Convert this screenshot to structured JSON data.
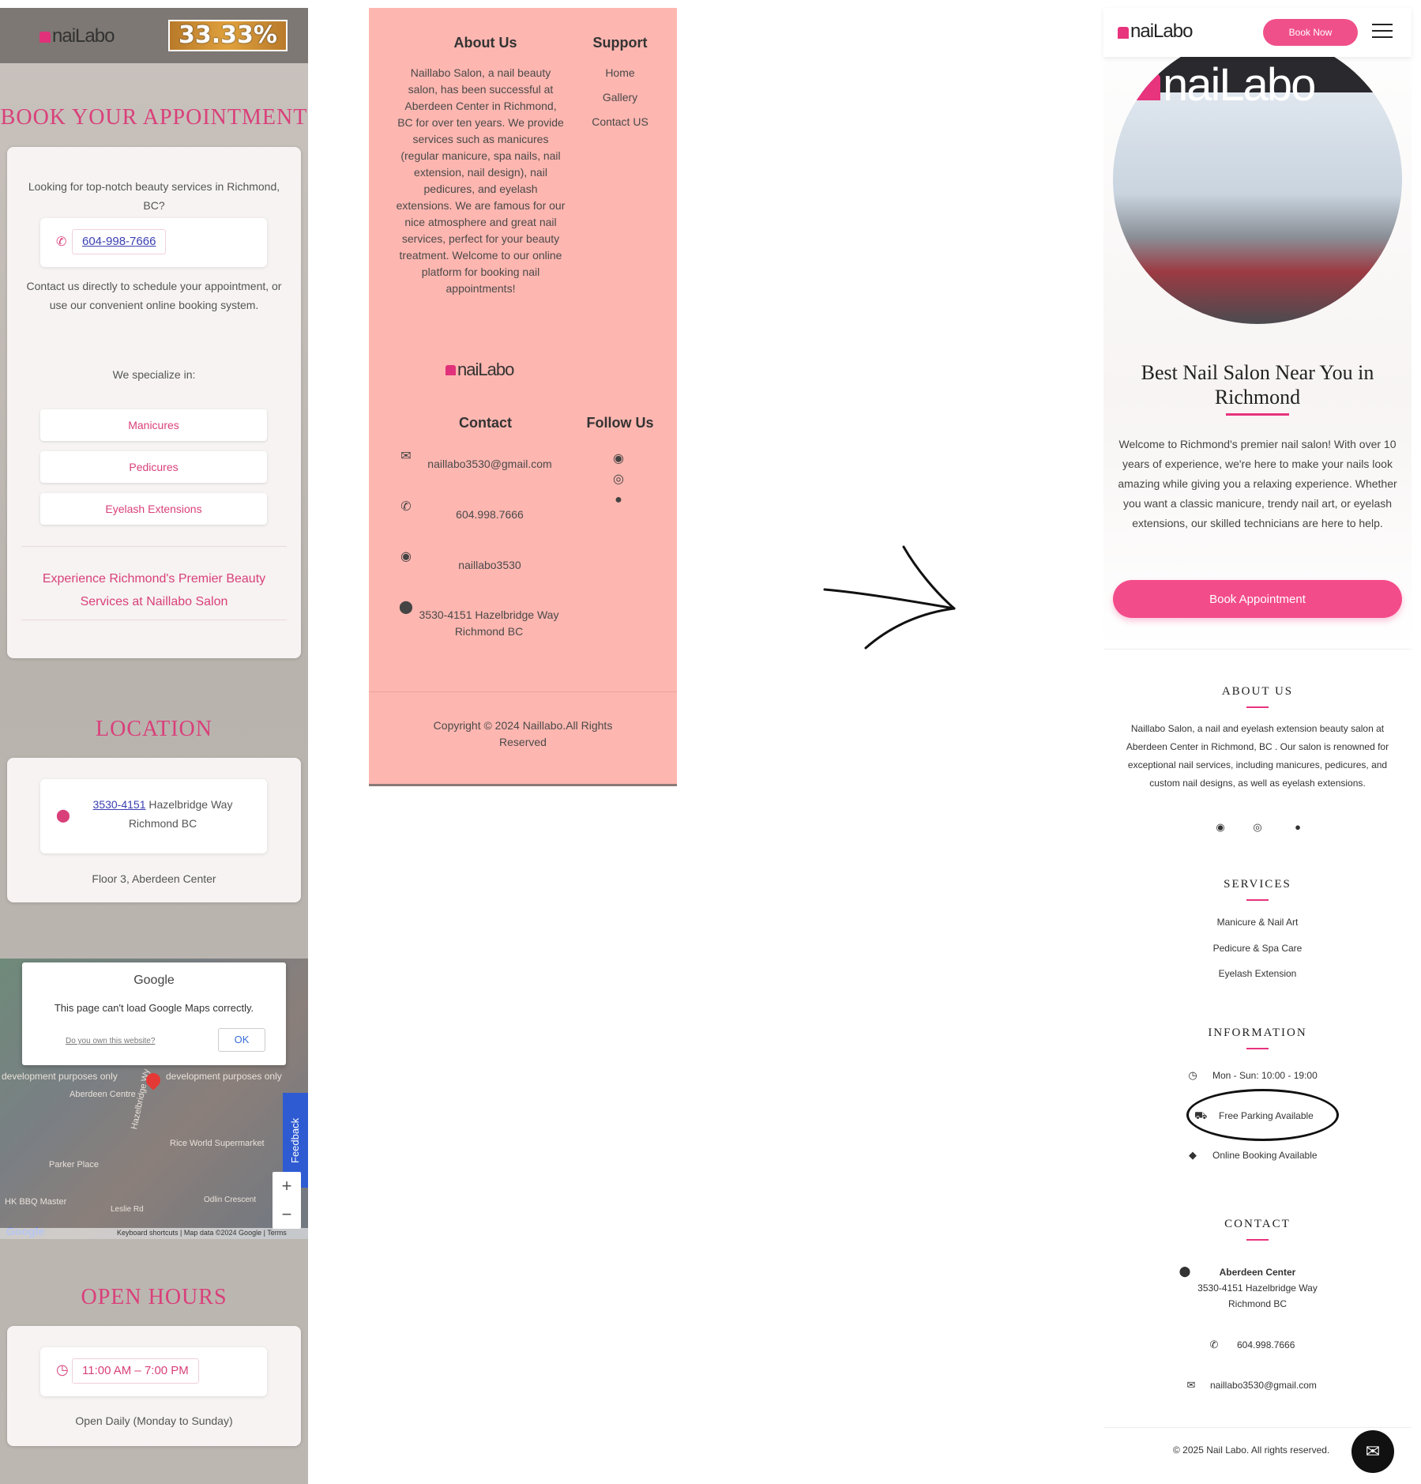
{
  "panel1": {
    "logo": "naiLabo",
    "promo": "33.33%",
    "book_title": "BOOK YOUR APPOINTMENT",
    "intro": "Looking for top-notch beauty services in Richmond, BC?",
    "phone": "604-998-7666",
    "contact_text": "Contact us directly to schedule your appointment, or use our convenient online booking system.",
    "specialize": "We specialize in:",
    "services": [
      "Manicures",
      "Pedicures",
      "Eyelash Extensions"
    ],
    "experience": "Experience Richmond's Premier Beauty Services at Naillabo Salon",
    "location_title": "LOCATION",
    "address_link": "3530-4151",
    "address_rest": "Hazelbridge Way Richmond BC",
    "floor": "Floor 3, Aberdeen Center",
    "map": {
      "google": "Google",
      "error": "This page can't load Google Maps correctly.",
      "own": "Do you own this website?",
      "ok": "OK",
      "dev": "development purposes only",
      "feedback": "Feedback",
      "zoom_in": "+",
      "zoom_out": "−",
      "footer": "Keyboard shortcuts | Map data ©2024 Google | Terms",
      "labels": [
        "Aberdeen Centre",
        "Parker Place",
        "Rice World Supermarket",
        "HK BBQ Master",
        "Hazelbridge Wy",
        "Leslie Rd",
        "Odlin Crescent"
      ]
    },
    "hours_title": "OPEN HOURS",
    "hours": "11:00 AM – 7:00 PM",
    "hours_note": "Open Daily (Monday to Sunday)"
  },
  "panel2": {
    "about_title": "About Us",
    "about_text": "Naillabo Salon, a nail beauty salon, has been successful at Aberdeen Center in Richmond, BC for over ten years. We provide services such as manicures (regular manicure, spa nails, nail extension, nail design), nail pedicures, and eyelash extensions. We are famous for our nice atmosphere and great nail services, perfect for your beauty treatment. Welcome to our online platform for booking nail appointments!",
    "support_title": "Support",
    "support_links": [
      "Home",
      "Gallery",
      "Contact US"
    ],
    "logo": "naiLabo",
    "contact_title": "Contact",
    "email": "naillabo3530@gmail.com",
    "phone": "604.998.7666",
    "wechat": "naillabo3530",
    "address": "3530-4151 Hazelbridge Way Richmond BC",
    "follow_title": "Follow Us",
    "copyright": "Copyright © 2024 Naillabo.All Rights Reserved"
  },
  "panel3": {
    "logo": "naiLabo",
    "book_now": "Book Now",
    "sign": "naiLabo",
    "hero_title": "Best Nail Salon Near You in Richmond",
    "hero_text": "Welcome to Richmond's premier nail salon! With over 10 years of experience, we're here to make your nails look amazing while giving you a relaxing experience. Whether you want a classic manicure, trendy nail art, or eyelash extensions, our skilled technicians are here to help.",
    "book_appt": "Book Appointment",
    "about_title": "ABOUT US",
    "about_text": "Naillabo Salon, a nail and eyelash extension beauty salon at Aberdeen Center in Richmond, BC . Our salon is renowned for exceptional nail services, including manicures, pedicures, and custom nail designs, as well as eyelash extensions.",
    "services_title": "SERVICES",
    "services": [
      "Manicure & Nail Art",
      "Pedicure & Spa Care",
      "Eyelash Extension"
    ],
    "info_title": "INFORMATION",
    "hours": "Mon - Sun: 10:00 - 19:00",
    "parking": "Free Parking Available",
    "booking": "Online Booking Available",
    "contact_title": "CONTACT",
    "center": "Aberdeen Center",
    "street": "3530-4151 Hazelbridge Way",
    "city": "Richmond BC",
    "phone": "604.998.7666",
    "email": "naillabo3530@gmail.com",
    "copyright": "© 2025 Nail Labo. All rights reserved."
  },
  "colors": {
    "accent": "#e8337d",
    "footer_bg": "#fdb6b0"
  }
}
